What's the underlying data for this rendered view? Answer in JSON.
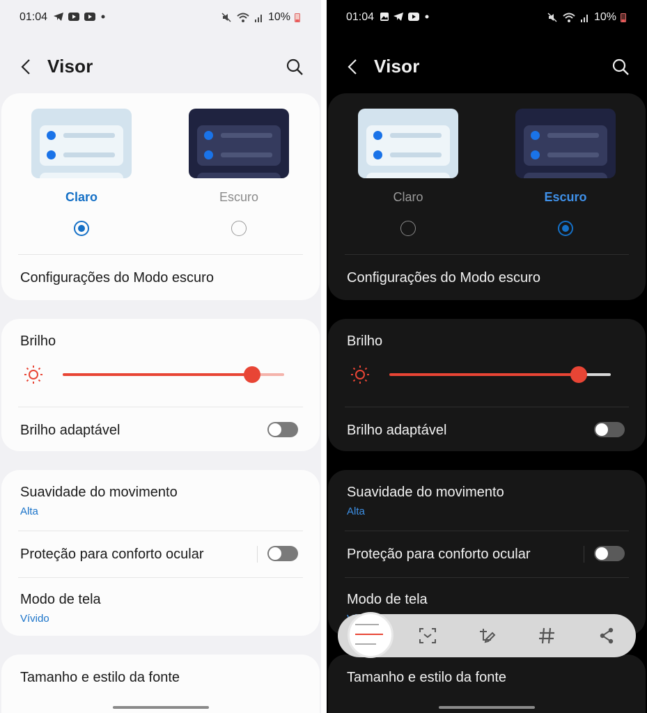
{
  "status_bar": {
    "time": "01:04",
    "battery": "10%"
  },
  "header": {
    "title": "Visor"
  },
  "theme": {
    "options": [
      {
        "label": "Claro"
      },
      {
        "label": "Escuro"
      }
    ]
  },
  "dark_mode_settings": "Configurações do Modo escuro",
  "brightness": {
    "label": "Brilho",
    "value_percent": 86
  },
  "adaptive_brightness": {
    "label": "Brilho adaptável",
    "enabled": false
  },
  "motion_smoothness": {
    "label": "Suavidade do movimento",
    "value": "Alta"
  },
  "eye_comfort": {
    "label": "Proteção para conforto ocular",
    "enabled": false
  },
  "screen_mode": {
    "label": "Modo de tela",
    "value": "Vívido"
  },
  "font_size_style": "Tamanho e estilo da fonte",
  "colors": {
    "accent": "#1570c6",
    "slider": "#e84535"
  },
  "screenshot_toolbar": {
    "buttons": [
      "scan-text-icon",
      "edit-icon",
      "hashtag-icon",
      "share-icon"
    ]
  }
}
